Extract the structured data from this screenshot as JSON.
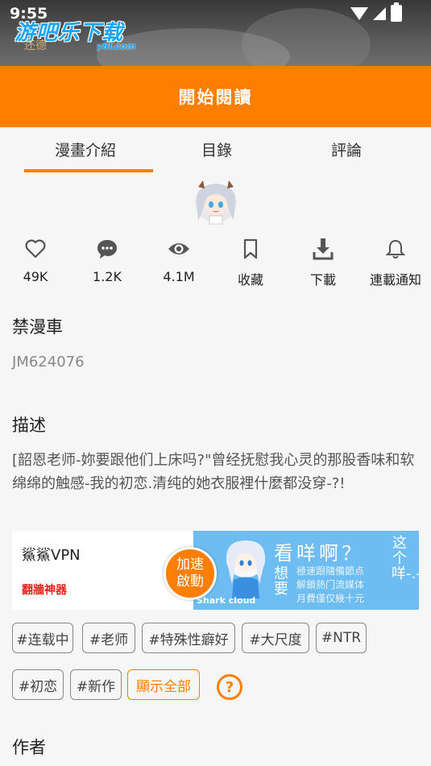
{
  "status_bar": {
    "time": "9:55"
  },
  "watermark": {
    "text": "游吧乐下载",
    "sub": "y8l.com",
    "deco": "还德"
  },
  "read_button": {
    "label": "開始閱讀"
  },
  "tabs": [
    {
      "label": "漫畫介紹",
      "active": true
    },
    {
      "label": "目錄",
      "active": false
    },
    {
      "label": "評論",
      "active": false
    }
  ],
  "stats": [
    {
      "icon": "heart-icon",
      "label": "49K"
    },
    {
      "icon": "comment-icon",
      "label": "1.2K"
    },
    {
      "icon": "eye-icon",
      "label": "4.1M"
    },
    {
      "icon": "bookmark-icon",
      "label": "收藏"
    },
    {
      "icon": "download-icon",
      "label": "下載"
    },
    {
      "icon": "bell-icon",
      "label": "連載通知"
    }
  ],
  "title": {
    "name": "禁漫車",
    "code": "JM624076"
  },
  "description": {
    "heading": "描述",
    "text": "[韶恩老师-妳要跟他们上床吗?\"曾经抚慰我心灵的那股香味和软绵绵的触感-我的初恋.清纯的她衣服裡什麼都没穿-?!"
  },
  "ad": {
    "title": "鯊鯊VPN",
    "subtitle": "翻牆神器",
    "button": "加速啟動",
    "headline": "看咩啊？",
    "left_vertical": "想要",
    "right_vertical": "这个咩-.-",
    "small_line1": "極速跟隨備節点",
    "small_line2": "解鎖熱门流媒体",
    "small_line3": "月費僅仅幾十元",
    "brand": "Shark cloud"
  },
  "tags": [
    "#连载中",
    "#老师",
    "#特殊性癖好",
    "#大尺度",
    "#NTR",
    "#初恋",
    "#新作"
  ],
  "show_all": "顯示全部",
  "help": "?",
  "author_heading": "作者",
  "colors": {
    "accent": "#fe7f00",
    "ad_red": "#e0251b"
  }
}
